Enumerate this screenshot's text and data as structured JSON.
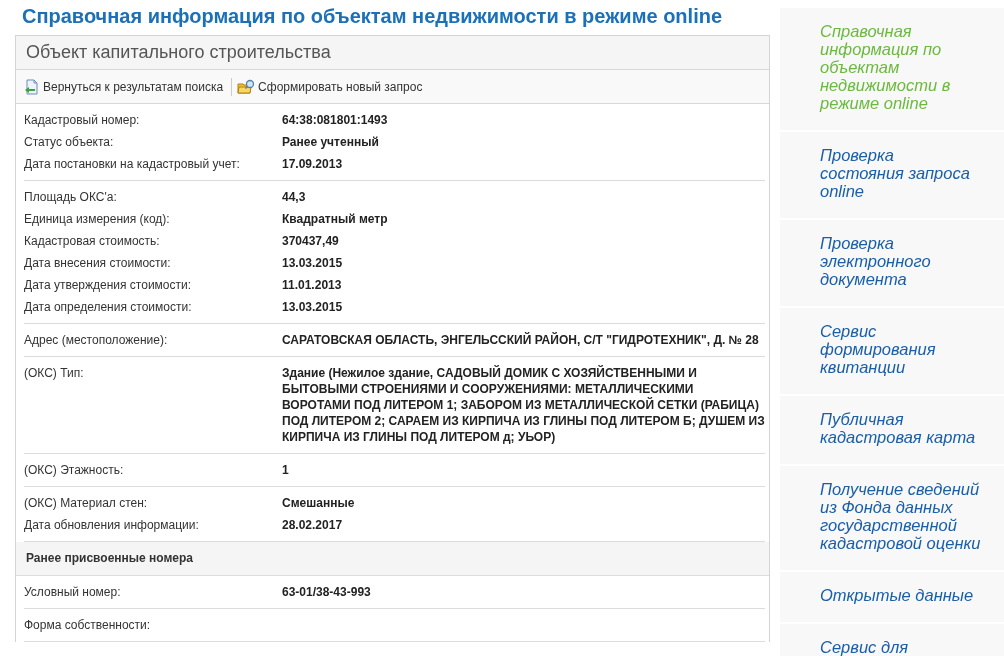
{
  "page_title": "Справочная информация по объектам недвижимости в режиме online",
  "panel": {
    "title": "Объект капитального строительства",
    "toolbar": [
      {
        "kind": "back",
        "label": "Вернуться к результатам поиска"
      },
      {
        "kind": "new",
        "label": "Сформировать новый запрос"
      }
    ],
    "sections": [
      {
        "kind": "group",
        "rows": [
          {
            "label": "Кадастровый номер:",
            "value": "64:38:081801:1493"
          },
          {
            "label": "Статус объекта:",
            "value": "Ранее учтенный"
          },
          {
            "label": "Дата постановки на кадастровый учет:",
            "value": "17.09.2013"
          }
        ]
      },
      {
        "kind": "group",
        "rows": [
          {
            "label": "Площадь ОКС'a:",
            "value": "44,3"
          },
          {
            "label": "Единица измерения (код):",
            "value": "Квадратный метр"
          },
          {
            "label": "Кадастровая стоимость:",
            "value": "370437,49"
          },
          {
            "label": "Дата внесения стоимости:",
            "value": "13.03.2015"
          },
          {
            "label": "Дата утверждения стоимости:",
            "value": "11.01.2013"
          },
          {
            "label": "Дата определения стоимости:",
            "value": "13.03.2015"
          }
        ]
      },
      {
        "kind": "group",
        "rows": [
          {
            "label": "Адрес (местоположение):",
            "value": "САРАТОВСКАЯ ОБЛАСТЬ, ЭНГЕЛЬССКИЙ РАЙОН, С/Т \"ГИДРОТЕХНИК\", Д. № 28"
          }
        ]
      },
      {
        "kind": "group",
        "rows": [
          {
            "label": "(ОКС) Тип:",
            "value": "Здание (Нежилое здание, САДОВЫЙ ДОМИК С ХОЗЯЙСТВЕННЫМИ И БЫТОВЫМИ СТРОЕНИЯМИ И СООРУЖЕНИЯМИ: МЕТАЛЛИЧЕСКИМИ ВОРОТАМИ ПОД ЛИТЕРОМ 1; ЗАБОРОМ ИЗ МЕТАЛЛИЧЕСКОЙ СЕТКИ (РАБИЦА) ПОД ЛИТЕРОМ 2; САРАЕМ ИЗ КИРПИЧА ИЗ ГЛИНЫ ПОД ЛИТЕРОМ Б; ДУШЕМ ИЗ КИРПИЧА ИЗ ГЛИНЫ ПОД ЛИТЕРОМ д; УЬОР)"
          }
        ]
      },
      {
        "kind": "group",
        "rows": [
          {
            "label": "(ОКС) Этажность:",
            "value": "1"
          }
        ]
      },
      {
        "kind": "group",
        "rows": [
          {
            "label": "(ОКС) Материал стен:",
            "value": "Смешанные"
          },
          {
            "label": "Дата обновления информации:",
            "value": "28.02.2017"
          }
        ]
      },
      {
        "kind": "heading",
        "text": "Ранее присвоенные номера"
      },
      {
        "kind": "group",
        "rows": [
          {
            "label": "Условный номер:",
            "value": "63-01/38-43-993"
          }
        ]
      },
      {
        "kind": "group",
        "rows": [
          {
            "label": "Форма собственности:"
          }
        ]
      }
    ]
  },
  "sidebar": {
    "items": [
      {
        "label": "Справочная информация по объектам недвижимости в режиме online",
        "selected": true
      },
      {
        "label": "Проверка состояния запроса online",
        "selected": false
      },
      {
        "label": "Проверка электронного документа",
        "selected": false
      },
      {
        "label": "Сервис формирования квитанции",
        "selected": false
      },
      {
        "label": "Публичная кадастровая карта",
        "selected": false
      },
      {
        "label": "Получение сведений из Фонда данных государственной кадастровой оценки",
        "selected": false
      },
      {
        "label": "Открытые данные",
        "selected": false
      },
      {
        "label": "Сервис для",
        "selected": false
      }
    ]
  }
}
